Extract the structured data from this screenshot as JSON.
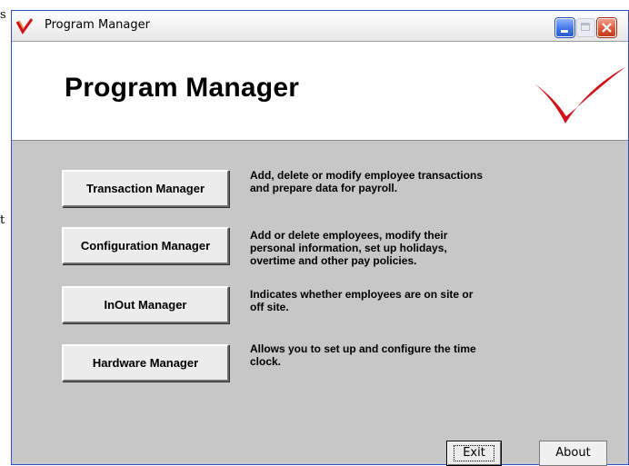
{
  "window": {
    "title": "Program Manager",
    "controls": [
      "minimize",
      "maximize",
      "close"
    ]
  },
  "outside": {
    "line1": "s",
    "line2": "t"
  },
  "header": {
    "title": "Program Manager",
    "logo": "red-checkmark-logo"
  },
  "managers": [
    {
      "label": "Transaction Manager",
      "description": [
        "Add, delete or modify employee transactions",
        "and prepare data for payroll."
      ]
    },
    {
      "label": "Configuration Manager",
      "description": [
        "Add or delete employees, modify their",
        "personal information, set up holidays,",
        "overtime and other pay policies."
      ]
    },
    {
      "label": "InOut Manager",
      "description": [
        "Indicates whether employees are on site or",
        "off site."
      ]
    },
    {
      "label": "Hardware Manager",
      "description": [
        "Allows you to set up and configure the time",
        "clock."
      ]
    }
  ],
  "footer": {
    "exit_label": "Exit",
    "about_label": "About"
  },
  "colors": {
    "logo_red": "#d0101a",
    "panel_gray": "#c7c7c7",
    "title_close": "#dc5a3a",
    "title_min": "#3e72e8"
  }
}
